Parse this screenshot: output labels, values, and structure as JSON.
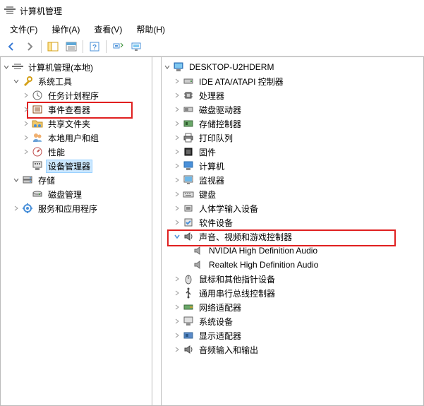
{
  "window": {
    "title": "计算机管理"
  },
  "menu": {
    "file": "文件(F)",
    "action": "操作(A)",
    "view": "查看(V)",
    "help": "帮助(H)"
  },
  "left_tree": {
    "root": "计算机管理(本地)",
    "system_tools": "系统工具",
    "task_scheduler": "任务计划程序",
    "event_viewer": "事件查看器",
    "shared_folders": "共享文件夹",
    "local_users": "本地用户和组",
    "performance": "性能",
    "device_manager": "设备管理器",
    "storage": "存储",
    "disk_management": "磁盘管理",
    "services_apps": "服务和应用程序"
  },
  "device_tree": {
    "computer_name": "DESKTOP-U2HDERM",
    "ide_ata": "IDE ATA/ATAPI 控制器",
    "processor": "处理器",
    "disk_drives": "磁盘驱动器",
    "storage_controllers": "存储控制器",
    "print_queues": "打印队列",
    "firmware": "固件",
    "computer": "计算机",
    "monitor": "监视器",
    "keyboard": "键盘",
    "hid": "人体学输入设备",
    "software_devices": "软件设备",
    "sound_video": "声音、视频和游戏控制器",
    "nvidia_audio": "NVIDIA High Definition Audio",
    "realtek_audio": "Realtek High Definition Audio",
    "mouse": "鼠标和其他指针设备",
    "usb": "通用串行总线控制器",
    "network": "网络适配器",
    "system_devices": "系统设备",
    "display": "显示适配器",
    "audio_io": "音频输入和输出"
  }
}
